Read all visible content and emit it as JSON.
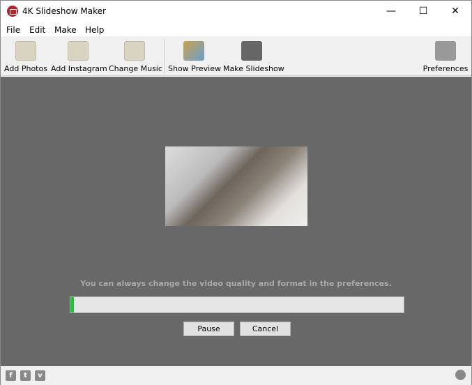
{
  "window": {
    "title": "4K Slideshow Maker",
    "minimize": "—",
    "maximize": "☐",
    "close": "✕"
  },
  "menu": [
    "File",
    "Edit",
    "Make",
    "Help"
  ],
  "toolbar": {
    "add_photos": "Add Photos",
    "add_instagram": "Add Instagram",
    "change_music": "Change Music",
    "show_preview": "Show Preview",
    "make_slideshow": "Make Slideshow",
    "preferences": "Preferences"
  },
  "main": {
    "hint": "You can always change the video quality and format in the preferences.",
    "progress_percent": 1,
    "pause": "Pause",
    "cancel": "Cancel"
  },
  "status": {
    "facebook": "f",
    "twitter": "t",
    "vimeo": "v"
  },
  "colors": {
    "background": "#686868",
    "progress": "#1fc43a"
  }
}
